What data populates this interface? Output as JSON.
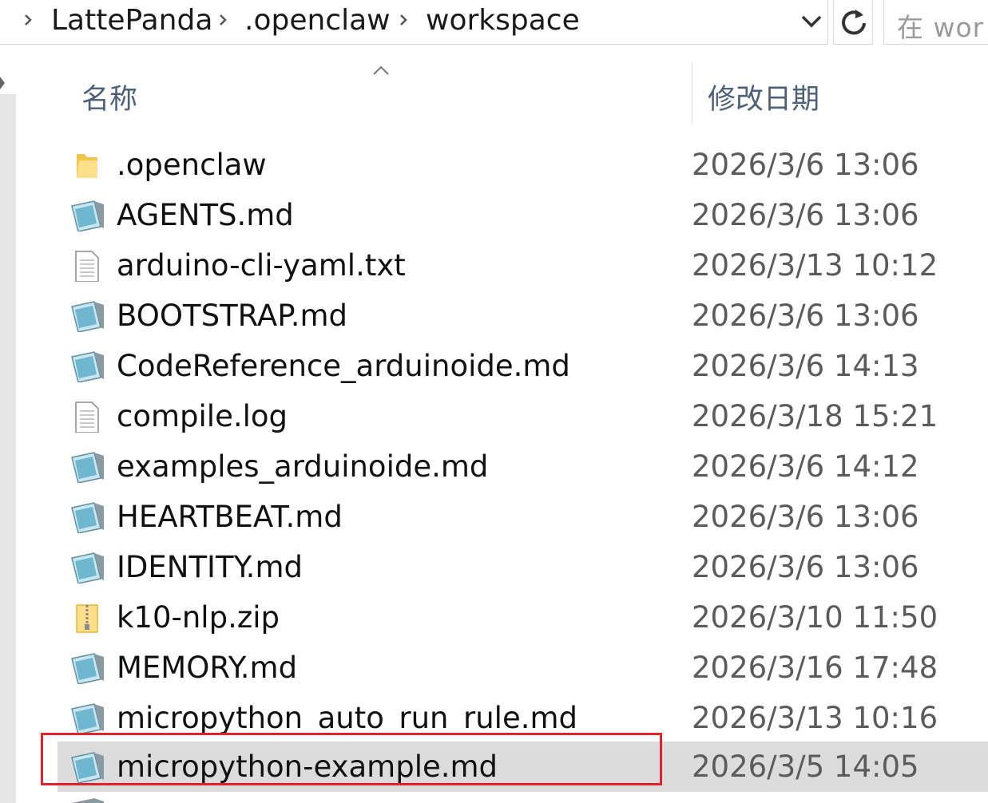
{
  "address_bar": {
    "breadcrumbs": [
      "LattePanda",
      ".openclaw",
      "workspace"
    ],
    "search_placeholder": "在 wor",
    "refresh_icon": "refresh-icon",
    "dropdown_icon": "chevron-down-icon"
  },
  "columns": {
    "name": "名称",
    "date_modified": "修改日期",
    "sort_indicator": "sort-ascending-icon"
  },
  "files": [
    {
      "name": ".openclaw",
      "date": "2026/3/6 13:06",
      "icon": "folder-icon"
    },
    {
      "name": "AGENTS.md",
      "date": "2026/3/6 13:06",
      "icon": "notepad-file-icon"
    },
    {
      "name": "arduino-cli-yaml.txt",
      "date": "2026/3/13 10:12",
      "icon": "text-file-icon"
    },
    {
      "name": "BOOTSTRAP.md",
      "date": "2026/3/6 13:06",
      "icon": "notepad-file-icon"
    },
    {
      "name": "CodeReference_arduinoide.md",
      "date": "2026/3/6 14:13",
      "icon": "notepad-file-icon"
    },
    {
      "name": "compile.log",
      "date": "2026/3/18 15:21",
      "icon": "text-file-icon"
    },
    {
      "name": "examples_arduinoide.md",
      "date": "2026/3/6 14:12",
      "icon": "notepad-file-icon"
    },
    {
      "name": "HEARTBEAT.md",
      "date": "2026/3/6 13:06",
      "icon": "notepad-file-icon"
    },
    {
      "name": "IDENTITY.md",
      "date": "2026/3/6 13:06",
      "icon": "notepad-file-icon"
    },
    {
      "name": "k10-nlp.zip",
      "date": "2026/3/10 11:50",
      "icon": "zip-folder-icon"
    },
    {
      "name": "MEMORY.md",
      "date": "2026/3/16 17:48",
      "icon": "notepad-file-icon"
    },
    {
      "name": "micropython_auto_run_rule.md",
      "date": "2026/3/13 10:16",
      "icon": "notepad-file-icon"
    },
    {
      "name": "micropython-example.md",
      "date": "2026/3/5 14:05",
      "icon": "notepad-file-icon",
      "selected": true
    }
  ],
  "colors": {
    "selection": "#dcdcdc",
    "highlight_border": "#e0232a",
    "header_text": "#4c607a"
  }
}
